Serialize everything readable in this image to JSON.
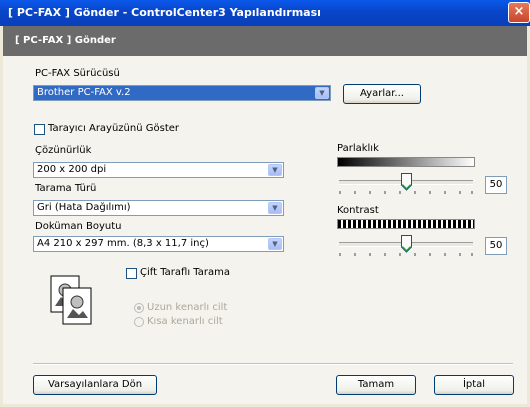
{
  "window": {
    "title": "[ PC-FAX ]  Gönder - ControlCenter3 Yapılandırması",
    "close": "×"
  },
  "header": {
    "title": "[ PC-FAX ]  Gönder"
  },
  "driver": {
    "label": "PC-FAX Sürücüsü",
    "value": "Brother PC-FAX v.2",
    "settings_button": "Ayarlar..."
  },
  "scanner_ui": {
    "label": "Tarayıcı Arayüzünü Göster",
    "checked": false
  },
  "resolution": {
    "label": "Çözünürlük",
    "value": "200 x 200 dpi"
  },
  "scan_type": {
    "label": "Tarama Türü",
    "value": "Gri (Hata Dağılımı)"
  },
  "doc_size": {
    "label": "Doküman Boyutu",
    "value": "A4 210 x 297 mm. (8,3 x 11,7 inç)"
  },
  "brightness": {
    "label": "Parlaklık",
    "value": "50",
    "level": 0.5
  },
  "contrast": {
    "label": "Kontrast",
    "value": "50",
    "level": 0.5
  },
  "duplex": {
    "label": "Çift Taraflı Tarama",
    "checked": false,
    "long_edge": "Uzun kenarlı cilt",
    "short_edge": "Kısa kenarlı cilt"
  },
  "footer": {
    "defaults_button": "Varsayılanlara Dön",
    "ok_button": "Tamam",
    "cancel_button": "İptal"
  },
  "colors": {
    "title_blue": "#0a4fd9",
    "header_gray": "#6b6b6b",
    "panel_bg": "#f4f3ee",
    "selection": "#316ac5"
  }
}
